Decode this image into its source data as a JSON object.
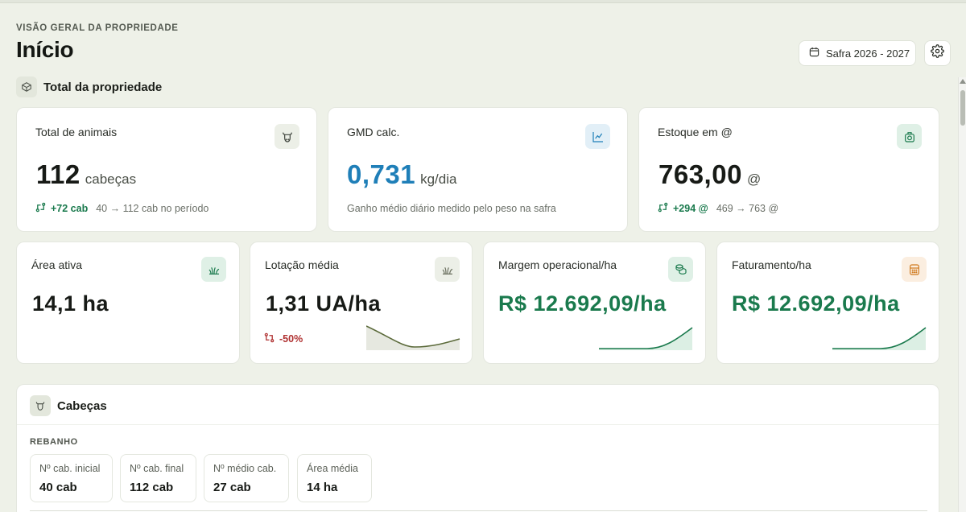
{
  "header": {
    "overline": "VISÃO GERAL DA PROPRIEDADE",
    "title": "Início",
    "safra_label": "Safra 2026 - 2027"
  },
  "section_total": {
    "title": "Total da propriedade",
    "icon": "box-icon"
  },
  "cards_row1": {
    "animais": {
      "label": "Total de animais",
      "value": "112",
      "unit": "cabeças",
      "delta": "+72 cab",
      "delta_detail": "40 → 112 cab no período",
      "icon": "cow-head-icon"
    },
    "gmd": {
      "label": "GMD calc.",
      "value": "0,731",
      "unit": "kg/dia",
      "sub": "Ganho médio diário medido pelo peso na safra",
      "icon": "line-chart-icon"
    },
    "estoque": {
      "label": "Estoque em @",
      "value": "763,00",
      "unit": "@",
      "delta": "+294 @",
      "delta_detail": "469 → 763 @",
      "icon": "weight-icon"
    }
  },
  "cards_row2": {
    "area": {
      "label": "Área ativa",
      "value": "14,1 ha",
      "icon": "grass-icon"
    },
    "lotacao": {
      "label": "Lotação média",
      "value": "1,31 UA/ha",
      "delta": "-50%",
      "icon": "grass-icon"
    },
    "margem": {
      "label": "Margem operacional/ha",
      "value": "R$ 12.692,09/ha",
      "icon": "coins-icon"
    },
    "faturamento": {
      "label": "Faturamento/ha",
      "value": "R$ 12.692,09/ha",
      "icon": "calculator-icon"
    }
  },
  "section_cabecas": {
    "title": "Cabeças",
    "group": "REBANHO",
    "items": [
      {
        "label": "Nº cab. inicial",
        "value": "40 cab"
      },
      {
        "label": "Nº cab. final",
        "value": "112 cab"
      },
      {
        "label": "Nº médio cab.",
        "value": "27 cab"
      },
      {
        "label": "Área média",
        "value": "14 ha"
      }
    ]
  },
  "colors": {
    "accent_green": "#1a7a4d",
    "accent_blue": "#1f7fb8",
    "negative_red": "#b03232",
    "background": "#eef1e8"
  }
}
